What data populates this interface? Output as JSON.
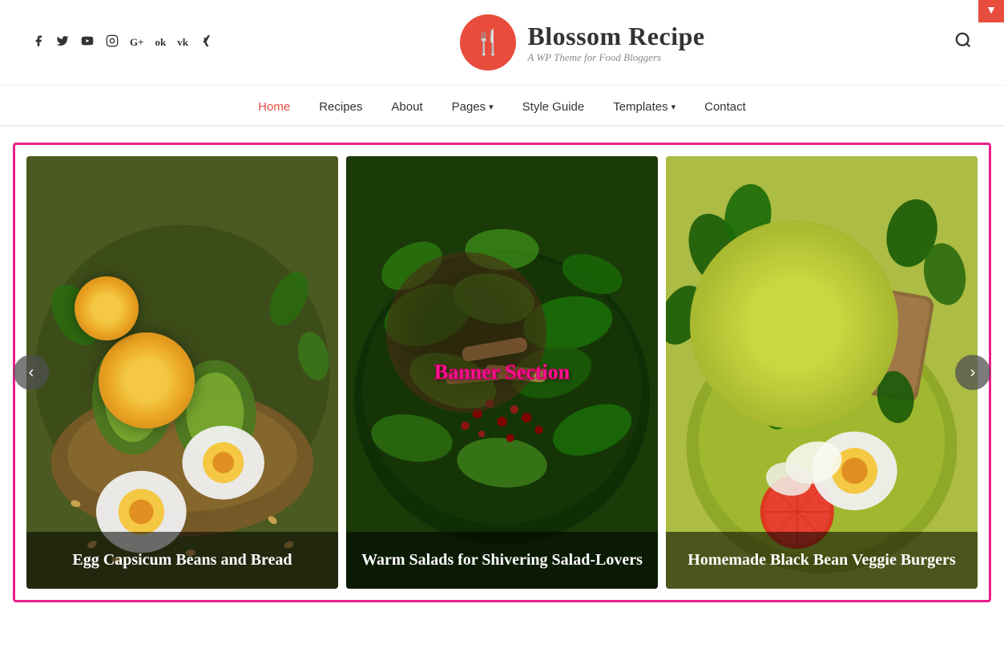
{
  "topBar": {
    "arrow": "▼"
  },
  "header": {
    "social": [
      {
        "name": "facebook",
        "icon": "f",
        "label": "Facebook"
      },
      {
        "name": "twitter",
        "icon": "𝕏",
        "label": "Twitter"
      },
      {
        "name": "youtube",
        "icon": "▶",
        "label": "YouTube"
      },
      {
        "name": "instagram",
        "icon": "◻",
        "label": "Instagram"
      },
      {
        "name": "google-plus",
        "icon": "G+",
        "label": "Google Plus"
      },
      {
        "name": "odnoklassniki",
        "icon": "ok",
        "label": "Odnoklassniki"
      },
      {
        "name": "vk",
        "icon": "VK",
        "label": "VK"
      },
      {
        "name": "xing",
        "icon": "✕",
        "label": "Xing"
      }
    ],
    "logoIcon": "🍴",
    "siteTitle": "Blossom Recipe",
    "siteTagline": "A WP Theme for Food Bloggers",
    "searchLabel": "Search"
  },
  "nav": {
    "items": [
      {
        "label": "Home",
        "active": true,
        "hasDropdown": false
      },
      {
        "label": "Recipes",
        "active": false,
        "hasDropdown": false
      },
      {
        "label": "About",
        "active": false,
        "hasDropdown": false
      },
      {
        "label": "Pages",
        "active": false,
        "hasDropdown": true
      },
      {
        "label": "Style Guide",
        "active": false,
        "hasDropdown": false
      },
      {
        "label": "Templates",
        "active": false,
        "hasDropdown": true
      },
      {
        "label": "Contact",
        "active": false,
        "hasDropdown": false
      }
    ]
  },
  "banner": {
    "sectionLabel": "Banner Section",
    "prevArrow": "‹",
    "nextArrow": "›",
    "cards": [
      {
        "id": "card-1",
        "title": "Egg Capsicum Beans and Bread",
        "colorClass": "card-img-1"
      },
      {
        "id": "card-2",
        "title": "Warm Salads for Shivering Salad-Lovers",
        "colorClass": "card-img-2"
      },
      {
        "id": "card-3",
        "title": "Homemade Black Bean Veggie Burgers",
        "colorClass": "card-img-3"
      }
    ]
  }
}
